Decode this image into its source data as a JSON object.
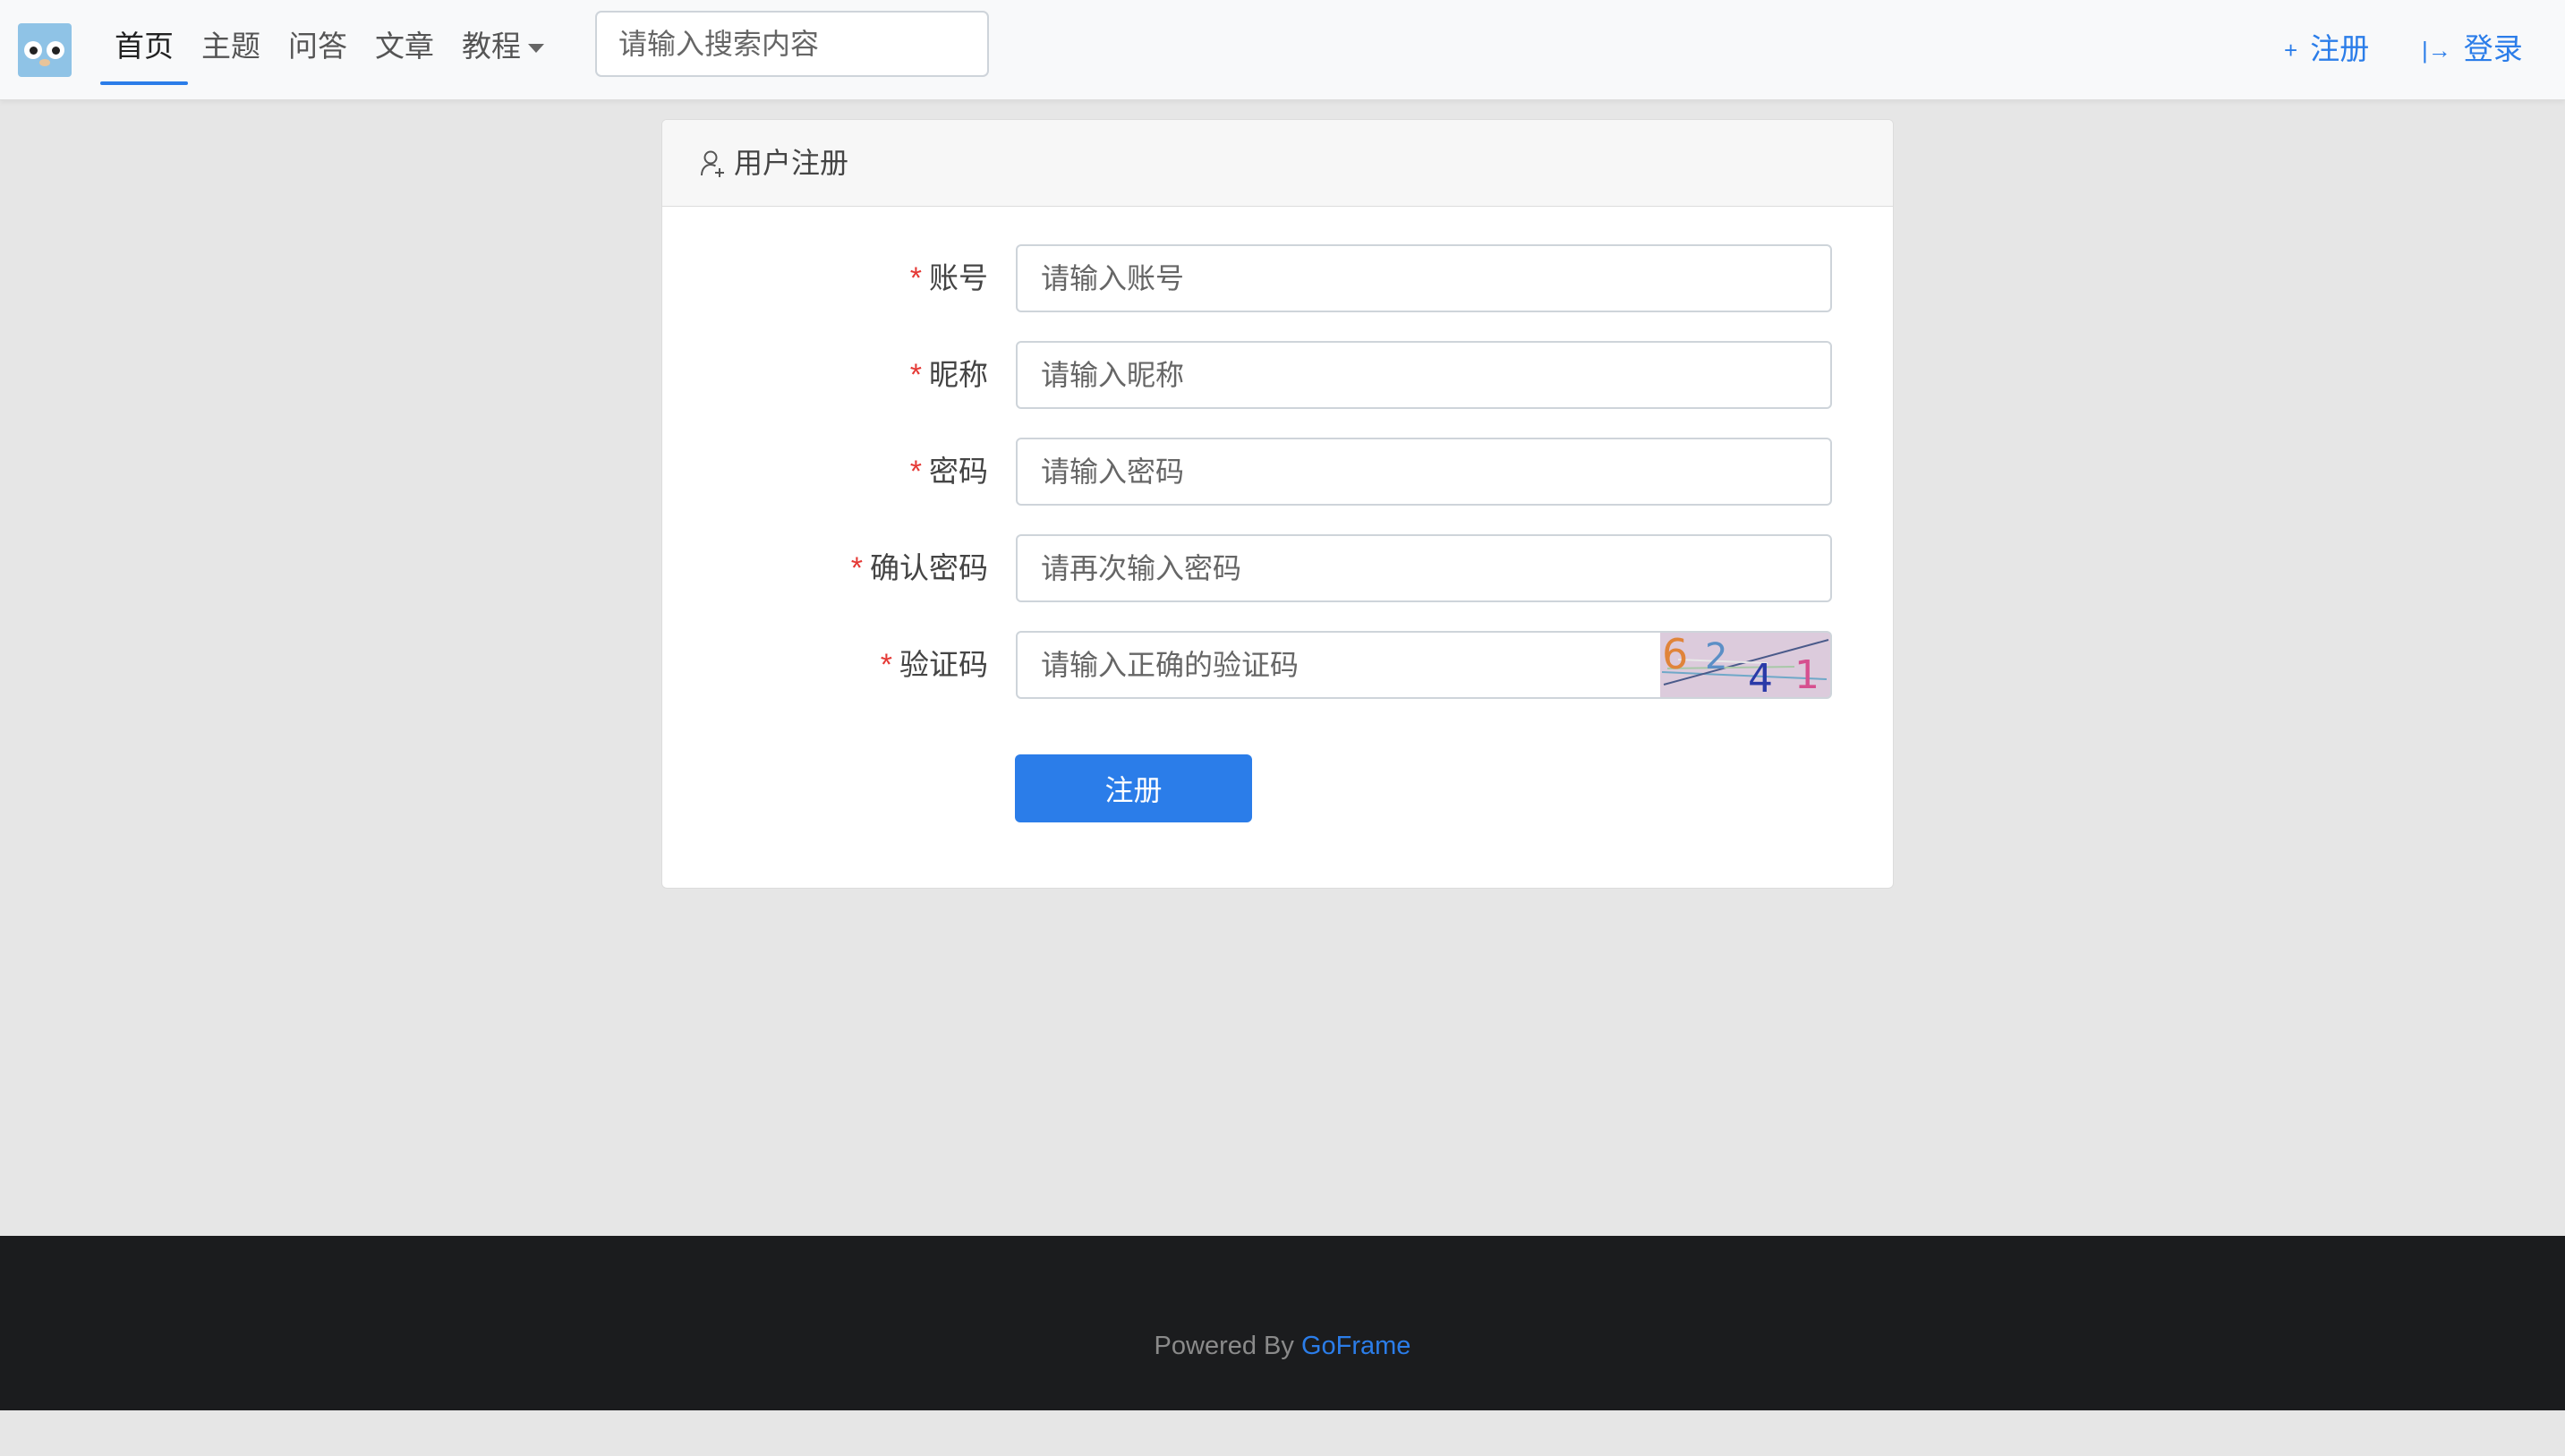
{
  "nav": {
    "items": [
      {
        "label": "首页",
        "active": true
      },
      {
        "label": "主题",
        "active": false
      },
      {
        "label": "问答",
        "active": false
      },
      {
        "label": "文章",
        "active": false
      },
      {
        "label": "教程",
        "active": false,
        "dropdown": true
      }
    ],
    "search_placeholder": "请输入搜索内容",
    "register_label": "注册",
    "login_label": "登录",
    "register_icon": "plus-icon",
    "login_icon": "login-arrow-icon"
  },
  "card": {
    "title": "用户注册",
    "icon": "user-add-icon",
    "fields": [
      {
        "label": "账号",
        "placeholder": "请输入账号",
        "required": true
      },
      {
        "label": "昵称",
        "placeholder": "请输入昵称",
        "required": true
      },
      {
        "label": "密码",
        "placeholder": "请输入密码",
        "required": true
      },
      {
        "label": "确认密码",
        "placeholder": "请再次输入密码",
        "required": true
      },
      {
        "label": "验证码",
        "placeholder": "请输入正确的验证码",
        "required": true
      }
    ],
    "required_mark": "*",
    "captcha_digits": [
      "6",
      "2",
      "4",
      "1"
    ],
    "submit_label": "注册"
  },
  "footer": {
    "prefix": "Powered By",
    "brand": "GoFrame"
  },
  "colors": {
    "accent": "#2b7de9",
    "required": "#e53935",
    "footer_bg": "#1b1c1e",
    "page_bg": "#e6e6e6"
  }
}
